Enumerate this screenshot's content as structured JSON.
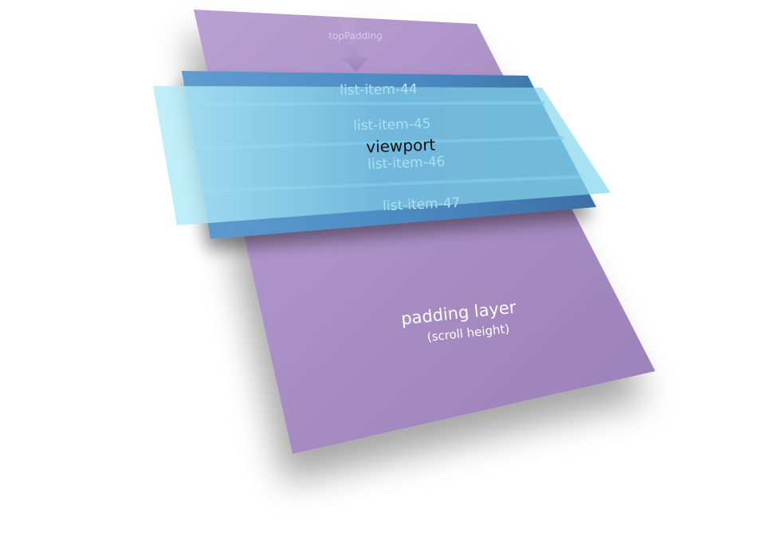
{
  "diagram": {
    "padding_layer": {
      "label": "padding layer",
      "sublabel": "(scroll height)",
      "color": "#a98ec3"
    },
    "top_padding": {
      "label": "topPadding"
    },
    "list_layer": {
      "color": "#4a82b8",
      "items": [
        {
          "label": "list-item-44"
        },
        {
          "label": "list-item-45"
        },
        {
          "label": "list-item-46"
        },
        {
          "label": "list-item-47"
        }
      ]
    },
    "viewport": {
      "label": "viewport",
      "color": "#7fd6ee"
    }
  }
}
